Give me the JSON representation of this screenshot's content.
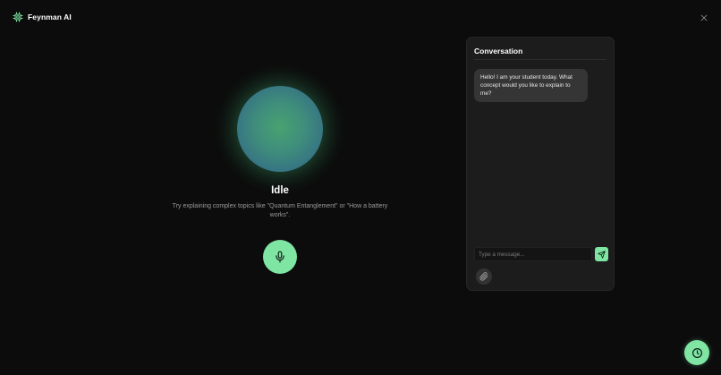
{
  "app": {
    "name": "Feynman AI",
    "logo_icon": "chip-icon"
  },
  "header": {
    "close_icon": "close-icon"
  },
  "stage": {
    "status": "Idle",
    "hint": "Try explaining complex topics like \"Quantum Entanglement\" or \"How a battery works\".",
    "mic_icon": "microphone-icon"
  },
  "conversation": {
    "title": "Conversation",
    "messages": [
      {
        "role": "assistant",
        "text": "Hello! I am your student today. What concept would you like to explain to me?"
      }
    ],
    "input": {
      "placeholder": "Type a message...",
      "value": ""
    },
    "send_icon": "send-icon",
    "attach_icon": "paperclip-icon"
  },
  "floating": {
    "history_icon": "clock-icon"
  },
  "colors": {
    "accent": "#7ee5a2",
    "background": "#0c0c0c",
    "panel": "#1c1c1c",
    "bubble": "#353535"
  }
}
